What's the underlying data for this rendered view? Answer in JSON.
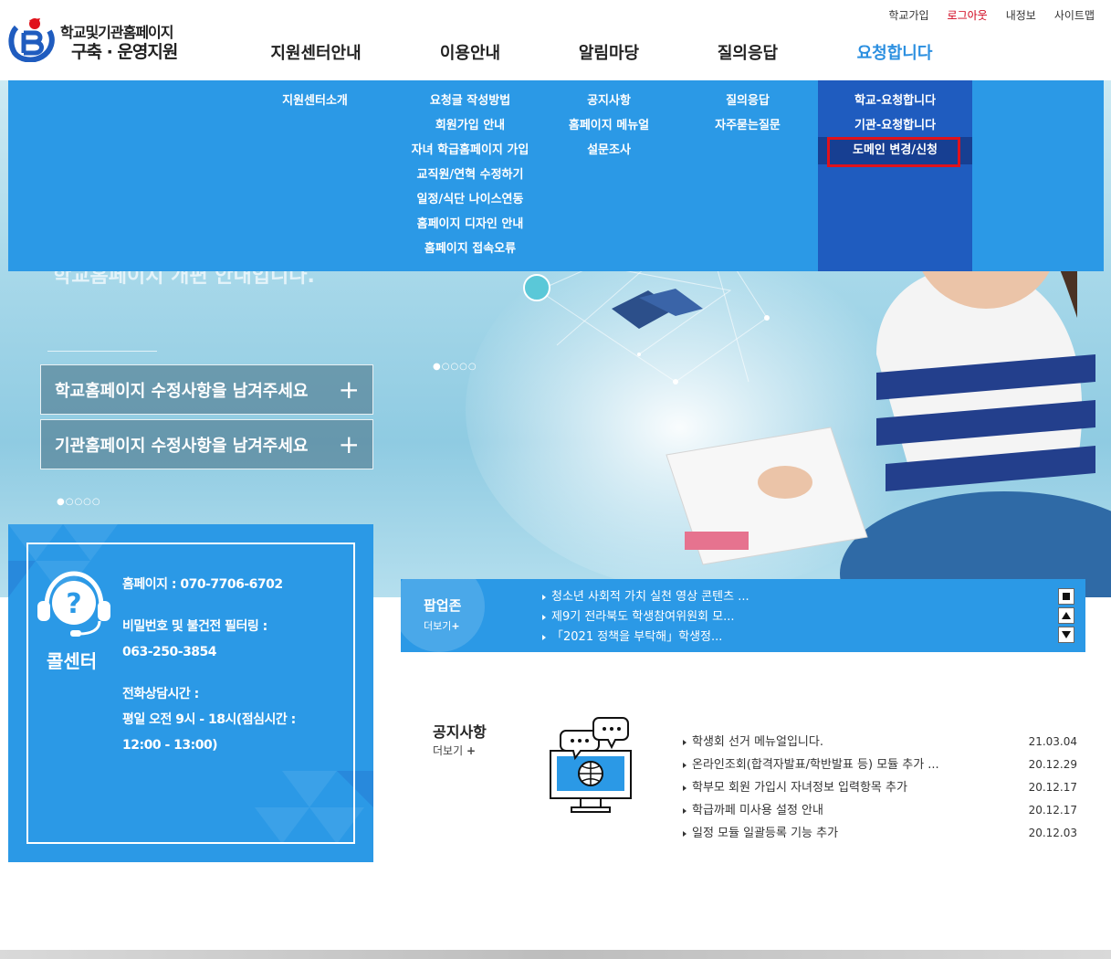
{
  "logo": {
    "line1": "학교및기관홈페이지",
    "line2": "구축 · 운영지원"
  },
  "util": {
    "signup": "학교가입",
    "logout": "로그아웃",
    "myinfo": "내정보",
    "sitemap": "사이트맵"
  },
  "gnb": [
    {
      "label": "지원센터안내"
    },
    {
      "label": "이용안내"
    },
    {
      "label": "알림마당"
    },
    {
      "label": "질의응답"
    },
    {
      "label": "요청합니다"
    }
  ],
  "dropdown": {
    "center": [
      "지원센터소개"
    ],
    "usage": [
      "요청글 작성방법",
      "회원가입 안내",
      "자녀 학급홈페이지 가입",
      "교직원/연혁 수정하기",
      "일정/식단 나이스연동",
      "홈페이지 디자인 안내",
      "홈페이지 접속오류"
    ],
    "notice": [
      "공지사항",
      "홈페이지 메뉴얼",
      "설문조사"
    ],
    "qna": [
      "질의응답",
      "자주묻는질문"
    ],
    "request": [
      "학교-요청합니다",
      "기관-요청합니다",
      "도메인 변경/신청"
    ]
  },
  "hero": {
    "ghost_text": "학교홈페이지 개편 안내입니다.",
    "btn_school": "학교홈페이지 수정사항을 남겨주세요",
    "btn_org": "기관홈페이지 수정사항을 남겨주세요",
    "plus": "+",
    "dots": "●○○○○"
  },
  "callcenter": {
    "label": "콜센터",
    "phone": "홈페이지 : 070-7706-6702",
    "filter_label": "비밀번호 및 불건전 필터링 :",
    "filter_phone": "063-250-3854",
    "hours_label": "전화상담시간 :",
    "hours_1": "평일 오전 9시 - 18시(점심시간 :",
    "hours_2": "12:00 - 13:00)"
  },
  "popup": {
    "title": "팝업존",
    "more": "더보기",
    "items": [
      "청소년 사회적 가치 실천 영상 콘텐츠 ...",
      "제9기 전라북도 학생참여위원회 모...",
      "「2021 정책을 부탁해」학생정..."
    ]
  },
  "notice": {
    "title": "공지사항",
    "more": "더보기",
    "items": [
      {
        "title": "학생회 선거 메뉴얼입니다.",
        "date": "21.03.04"
      },
      {
        "title": "온라인조회(합격자발표/학반발표 등) 모듈 추가 ...",
        "date": "20.12.29"
      },
      {
        "title": "학부모 회원 가입시 자녀정보 입력항목 추가",
        "date": "20.12.17"
      },
      {
        "title": "학급까페 미사용 설정 안내",
        "date": "20.12.17"
      },
      {
        "title": "일정 모듈 일괄등록 기능 추가",
        "date": "20.12.03"
      }
    ]
  },
  "colors": {
    "primary": "#2b99e6",
    "active_menu": "#1f5cbf",
    "highlight": "#e0121b"
  }
}
